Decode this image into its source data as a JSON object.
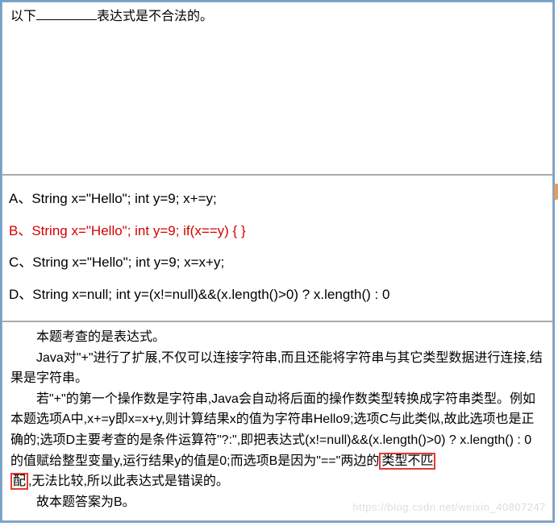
{
  "question": {
    "prefix": "以下",
    "suffix": "表达式是不合法的。"
  },
  "options": {
    "a": "A、String x=\"Hello\"; int y=9; x+=y;",
    "b": "B、String x=\"Hello\"; int y=9; if(x==y) { }",
    "c": "C、String x=\"Hello\"; int y=9; x=x+y;",
    "d": "D、String x=null;  int y=(x!=null)&&(x.length()>0) ? x.length() : 0"
  },
  "explanation": {
    "p1": "本题考查的是表达式。",
    "p2": "Java对\"+\"进行了扩展,不仅可以连接字符串,而且还能将字符串与其它类型数据进行连接,结果是字符串。",
    "p3a": "若\"+\"的第一个操作数是字符串,Java会自动将后面的操作数类型转换成字符串类型。例如本题选项A中,x+=y即x=x+y,则计算结果x的值为字符串Hello9;选项C与此类似,故此选项也是正确的;选项D主要考查的是条件运算符\"?:\",即把表达式(x!=null)&&(x.length()>0) ? x.length() : 0的值赋给整型变量y,运行结果y的值是0;而选项B是因为\"==\"两边的",
    "p3h1": "类型不匹",
    "p3h2": "配",
    "p3b": ",无法比较,所以此表达式是错误的。",
    "p4": "故本题答案为B。"
  },
  "watermark": "https://blog.csdn.net/weixin_40807247"
}
